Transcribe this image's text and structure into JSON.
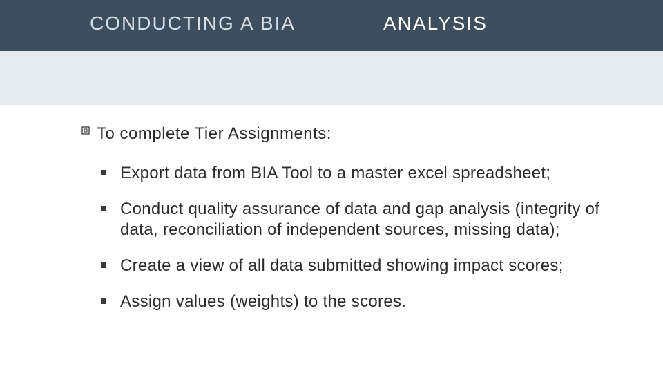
{
  "title": {
    "left": "CONDUCTING A BIA",
    "right": "ANALYSIS"
  },
  "intro": "To complete Tier Assignments:",
  "bullets": [
    "Export data from BIA Tool to a master excel spreadsheet;",
    "Conduct quality assurance of data and gap analysis (integrity of data, reconciliation of independent sources, missing data);",
    "Create a view of all data submitted showing impact scores;",
    "Assign values (weights) to the scores."
  ]
}
